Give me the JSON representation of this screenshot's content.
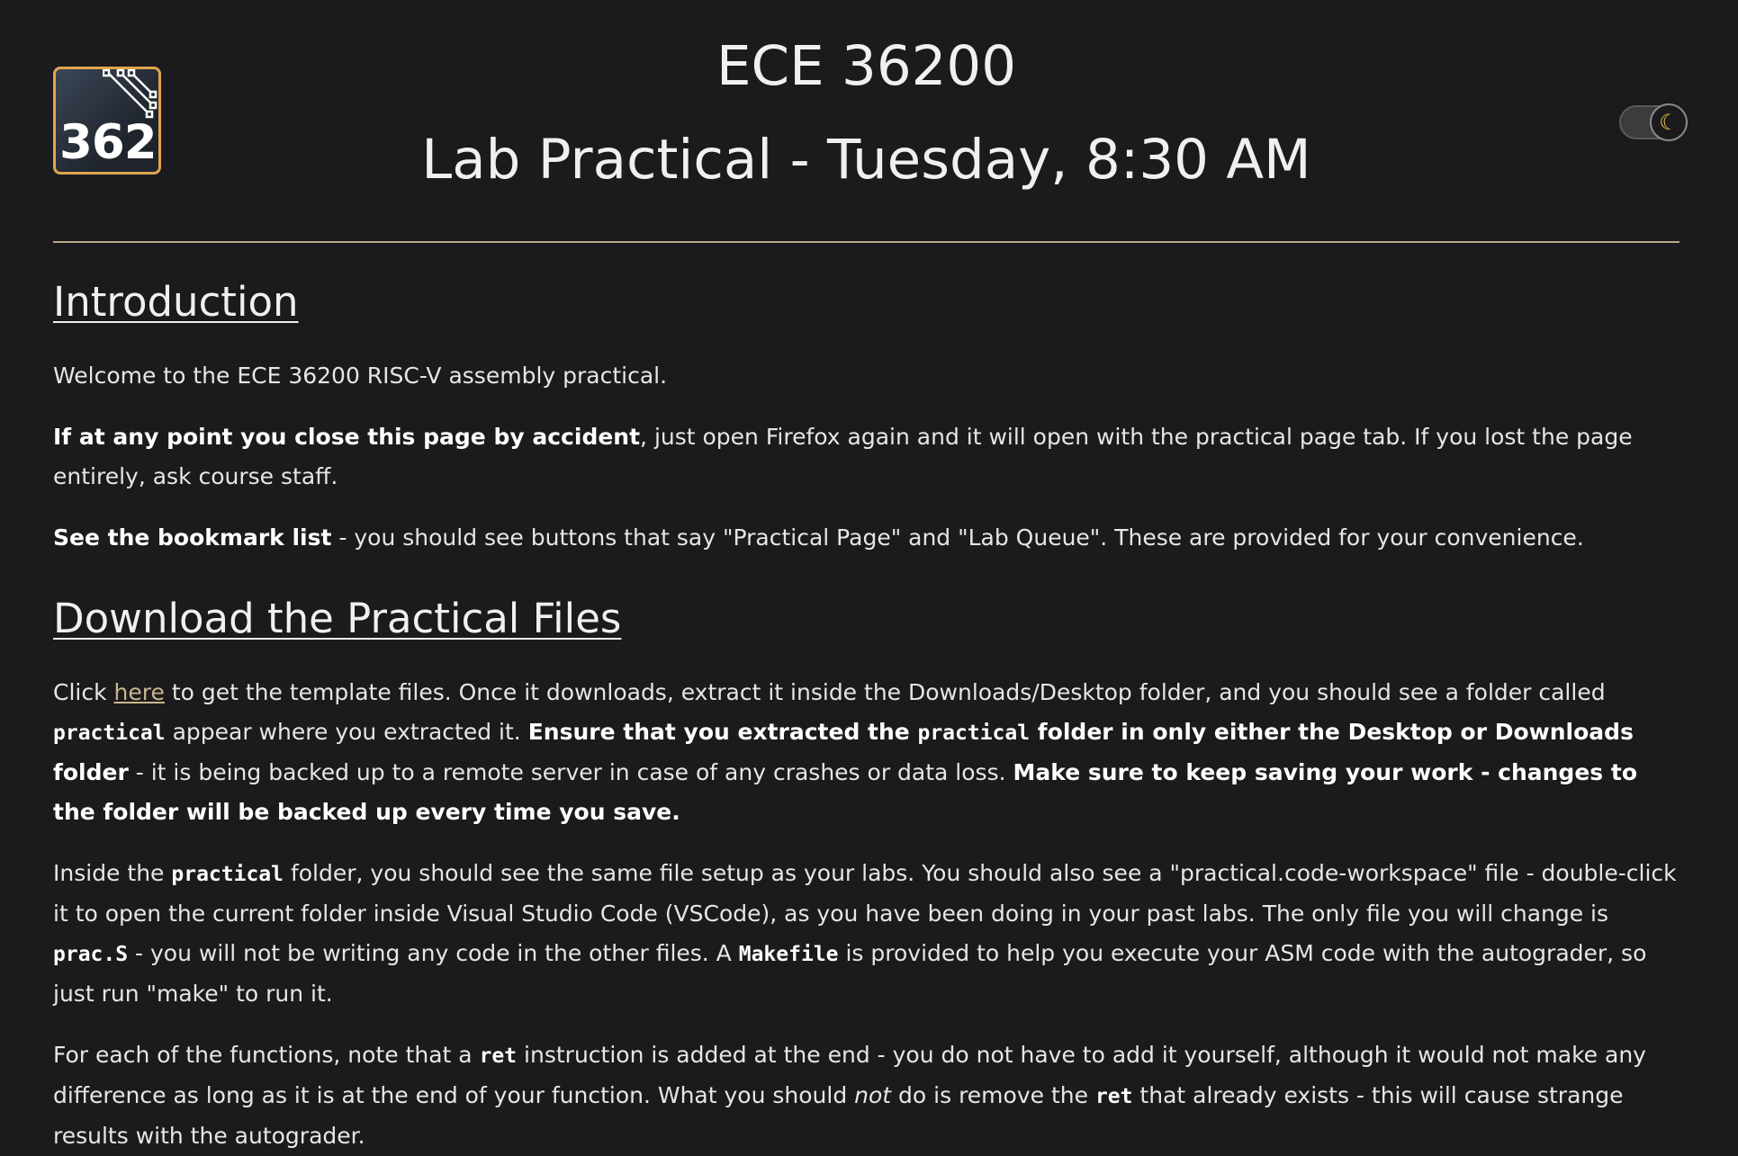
{
  "header": {
    "logo_text": "362",
    "course": "ECE 36200",
    "subtitle": "Lab Practical - Tuesday, 8:30 AM",
    "theme_toggle_icon": "moon-icon"
  },
  "intro": {
    "heading": "Introduction",
    "welcome": "Welcome to the ECE 36200 RISC-V assembly practical.",
    "p2_bold": "If at any point you close this page by accident",
    "p2_rest": ", just open Firefox again and it will open with the practical page tab. If you lost the page entirely, ask course staff.",
    "p3_bold": "See the bookmark list",
    "p3_rest": " - you should see buttons that say \"Practical Page\" and \"Lab Queue\". These are provided for your convenience."
  },
  "download": {
    "heading": "Download the Practical Files",
    "p1_a": "Click ",
    "p1_link": "here",
    "p1_b": " to get the template files. Once it downloads, extract it inside the Downloads/Desktop folder, and you should see a folder called ",
    "p1_code1": "practical",
    "p1_c": " appear where you extracted it. ",
    "p1_bold1": "Ensure that you extracted the ",
    "p1_code2": "practical",
    "p1_bold2": " folder in only either the Desktop or Downloads folder",
    "p1_d": " - it is being backed up to a remote server in case of any crashes or data loss. ",
    "p1_bold3": "Make sure to keep saving your work - changes to the folder will be backed up every time you save.",
    "p2_a": "Inside the ",
    "p2_code1": "practical",
    "p2_b": " folder, you should see the same file setup as your labs. You should also see a \"practical.code-workspace\" file - double-click it to open the current folder inside Visual Studio Code (VSCode), as you have been doing in your past labs. The only file you will change is ",
    "p2_code2": "prac.S",
    "p2_c": " - you will not be writing any code in the other files. A ",
    "p2_code3": "Makefile",
    "p2_d": " is provided to help you execute your ASM code with the autograder, so just run \"make\" to run it.",
    "p3_a": "For each of the functions, note that a ",
    "p3_code1": "ret",
    "p3_b": " instruction is added at the end - you do not have to add it yourself, although it would not make any difference as long as it is at the end of your function. What you should ",
    "p3_em": "not",
    "p3_c": " do is remove the ",
    "p3_code2": "ret",
    "p3_d": " that already exists - this will cause strange results with the autograder."
  }
}
